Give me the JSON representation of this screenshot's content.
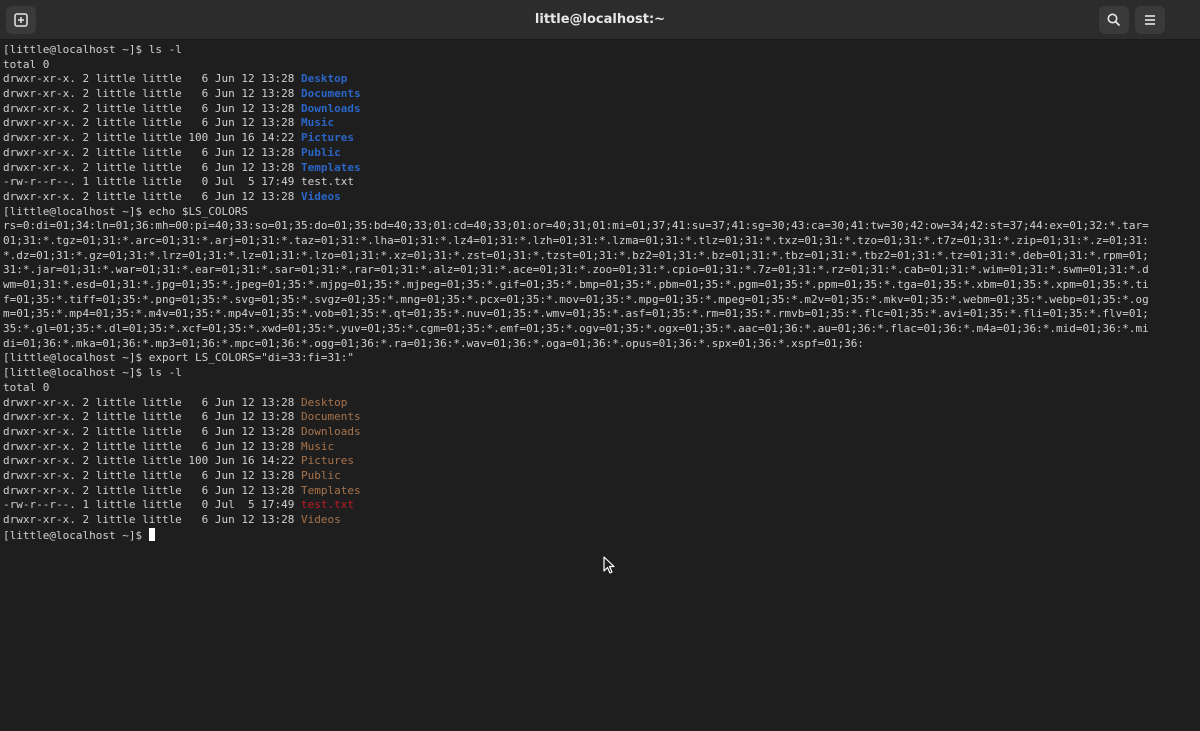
{
  "window": {
    "title": "little@localhost:~"
  },
  "headerbar": {
    "new_tab_icon": "new-tab-icon",
    "search_icon": "search-icon",
    "menu_icon": "hamburger-menu-icon"
  },
  "colors": {
    "background": "#1e1e1e",
    "text": "#d0d0d0",
    "dir_default": "#2a65c7",
    "dir_custom": "#a8734a",
    "file_custom": "#c01c28"
  },
  "terminal": {
    "prompt": "[little@localhost ~]$ ",
    "cmd1": "ls -l",
    "total1": "total 0",
    "listing1": [
      {
        "meta": "drwxr-xr-x. 2 little little   6 Jun 12 13:28 ",
        "name": "Desktop"
      },
      {
        "meta": "drwxr-xr-x. 2 little little   6 Jun 12 13:28 ",
        "name": "Documents"
      },
      {
        "meta": "drwxr-xr-x. 2 little little   6 Jun 12 13:28 ",
        "name": "Downloads"
      },
      {
        "meta": "drwxr-xr-x. 2 little little   6 Jun 12 13:28 ",
        "name": "Music"
      },
      {
        "meta": "drwxr-xr-x. 2 little little 100 Jun 16 14:22 ",
        "name": "Pictures"
      },
      {
        "meta": "drwxr-xr-x. 2 little little   6 Jun 12 13:28 ",
        "name": "Public"
      },
      {
        "meta": "drwxr-xr-x. 2 little little   6 Jun 12 13:28 ",
        "name": "Templates"
      },
      {
        "meta": "-rw-r--r--. 1 little little   0 Jul  5 17:49 ",
        "name": "test.txt"
      },
      {
        "meta": "drwxr-xr-x. 2 little little   6 Jun 12 13:28 ",
        "name": "Videos"
      }
    ],
    "cmd2": "echo $LS_COLORS",
    "ls_colors_lines": [
      "rs=0:di=01;34:ln=01;36:mh=00:pi=40;33:so=01;35:do=01;35:bd=40;33;01:cd=40;33;01:or=40;31;01:mi=01;37;41:su=37;41:sg=30;43:ca=30;41:tw=30;42:ow=34;42:st=37;44:ex=01;32:*.tar=",
      "01;31:*.tgz=01;31:*.arc=01;31:*.arj=01;31:*.taz=01;31:*.lha=01;31:*.lz4=01;31:*.lzh=01;31:*.lzma=01;31:*.tlz=01;31:*.txz=01;31:*.tzo=01;31:*.t7z=01;31:*.zip=01;31:*.z=01;31:",
      "*.dz=01;31:*.gz=01;31:*.lrz=01;31:*.lz=01;31:*.lzo=01;31:*.xz=01;31:*.zst=01;31:*.tzst=01;31:*.bz2=01;31:*.bz=01;31:*.tbz=01;31:*.tbz2=01;31:*.tz=01;31:*.deb=01;31:*.rpm=01;",
      "31:*.jar=01;31:*.war=01;31:*.ear=01;31:*.sar=01;31:*.rar=01;31:*.alz=01;31:*.ace=01;31:*.zoo=01;31:*.cpio=01;31:*.7z=01;31:*.rz=01;31:*.cab=01;31:*.wim=01;31:*.swm=01;31:*.d",
      "wm=01;31:*.esd=01;31:*.jpg=01;35:*.jpeg=01;35:*.mjpg=01;35:*.mjpeg=01;35:*.gif=01;35:*.bmp=01;35:*.pbm=01;35:*.pgm=01;35:*.ppm=01;35:*.tga=01;35:*.xbm=01;35:*.xpm=01;35:*.ti",
      "f=01;35:*.tiff=01;35:*.png=01;35:*.svg=01;35:*.svgz=01;35:*.mng=01;35:*.pcx=01;35:*.mov=01;35:*.mpg=01;35:*.mpeg=01;35:*.m2v=01;35:*.mkv=01;35:*.webm=01;35:*.webp=01;35:*.og",
      "m=01;35:*.mp4=01;35:*.m4v=01;35:*.mp4v=01;35:*.vob=01;35:*.qt=01;35:*.nuv=01;35:*.wmv=01;35:*.asf=01;35:*.rm=01;35:*.rmvb=01;35:*.flc=01;35:*.avi=01;35:*.fli=01;35:*.flv=01;",
      "35:*.gl=01;35:*.dl=01;35:*.xcf=01;35:*.xwd=01;35:*.yuv=01;35:*.cgm=01;35:*.emf=01;35:*.ogv=01;35:*.ogx=01;35:*.aac=01;36:*.au=01;36:*.flac=01;36:*.m4a=01;36:*.mid=01;36:*.mi",
      "di=01;36:*.mka=01;36:*.mp3=01;36:*.mpc=01;36:*.ogg=01;36:*.ra=01;36:*.wav=01;36:*.oga=01;36:*.opus=01;36:*.spx=01;36:*.xspf=01;36:"
    ],
    "cmd3": "export LS_COLORS=\"di=33:fi=31:\"",
    "cmd4": "ls -l",
    "total2": "total 0",
    "listing2": [
      {
        "meta": "drwxr-xr-x. 2 little little   6 Jun 12 13:28 ",
        "name": "Desktop"
      },
      {
        "meta": "drwxr-xr-x. 2 little little   6 Jun 12 13:28 ",
        "name": "Documents"
      },
      {
        "meta": "drwxr-xr-x. 2 little little   6 Jun 12 13:28 ",
        "name": "Downloads"
      },
      {
        "meta": "drwxr-xr-x. 2 little little   6 Jun 12 13:28 ",
        "name": "Music"
      },
      {
        "meta": "drwxr-xr-x. 2 little little 100 Jun 16 14:22 ",
        "name": "Pictures"
      },
      {
        "meta": "drwxr-xr-x. 2 little little   6 Jun 12 13:28 ",
        "name": "Public"
      },
      {
        "meta": "drwxr-xr-x. 2 little little   6 Jun 12 13:28 ",
        "name": "Templates"
      },
      {
        "meta": "-rw-r--r--. 1 little little   0 Jul  5 17:49 ",
        "name": "test.txt"
      },
      {
        "meta": "drwxr-xr-x. 2 little little   6 Jun 12 13:28 ",
        "name": "Videos"
      }
    ]
  }
}
